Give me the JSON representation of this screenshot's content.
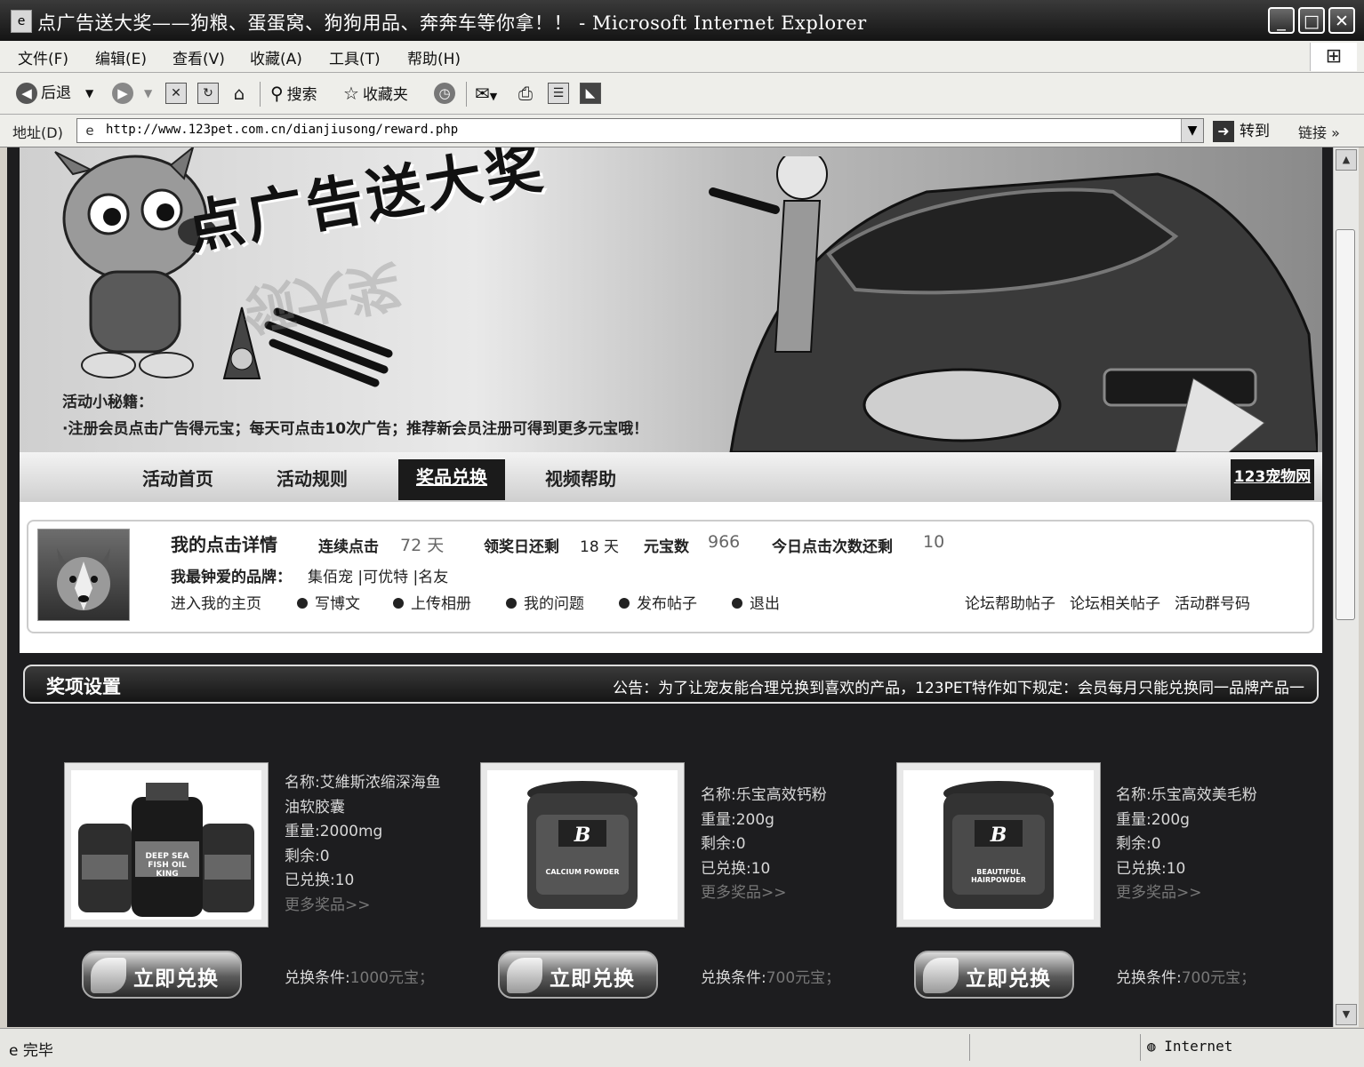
{
  "window": {
    "title": "点广告送大奖——狗粮、蛋蛋窝、狗狗用品、奔奔车等你拿！！ - Microsoft Internet Explorer"
  },
  "menu": [
    "文件(F)",
    "编辑(E)",
    "查看(V)",
    "收藏(A)",
    "工具(T)",
    "帮助(H)"
  ],
  "toolbar": {
    "back": "后退",
    "search": "搜索",
    "favorites": "收藏夹"
  },
  "address": {
    "label": "地址(D)",
    "url": "http://www.123pet.com.cn/dianjiusong/reward.php",
    "go": "转到",
    "links": "链接"
  },
  "banner": {
    "title": "点广告送大奖",
    "tip_title": "活动小秘籍：",
    "tip_text": "·注册会员点击广告得元宝；每天可点击10次广告；推荐新会员注册可得到更多元宝哦！"
  },
  "nav": {
    "items": [
      "活动首页",
      "活动规则",
      "奖品兑换",
      "视频帮助"
    ],
    "active": "奖品兑换",
    "site": "123宠物网"
  },
  "user": {
    "heading": "我的点击详情",
    "consecutive_label": "连续点击",
    "consecutive_value": "72 天",
    "days_left_label": "领奖日还剩",
    "days_left_value": "18 天",
    "ingots_label": "元宝数",
    "ingots_value": "966",
    "clicks_left_label": "今日点击次数还剩",
    "clicks_left_value": "10",
    "brands_label": "我最钟爱的品牌：",
    "brands": "集佰宠 |可优特 |名友",
    "links": [
      "进入我的主页",
      "写博文",
      "上传相册",
      "我的问题",
      "发布帖子",
      "退出"
    ],
    "right_links": [
      "论坛帮助帖子",
      "论坛相关帖子",
      "活动群号码"
    ]
  },
  "prizes": {
    "heading": "奖项设置",
    "notice": "公告：为了让宠友能合理兑换到喜欢的产品，123PET特作如下规定：会员每月只能兑换同一品牌产品一",
    "items": [
      {
        "name_line1": "名称:艾維斯浓缩深海鱼",
        "name_line2": "油软胶囊",
        "weight": "重量:2000mg",
        "remain": "剩余:0",
        "exchanged": "已兑换:10",
        "more": "更多奖品>>",
        "button": "立即兑换",
        "cond_label": "兑换条件:",
        "cond_value": "1000元宝；",
        "product_text": "DEEP SEA FISH OIL KING"
      },
      {
        "name_line1": "名称:乐宝高效钙粉",
        "name_line2": "",
        "weight": "重量:200g",
        "remain": "剩余:0",
        "exchanged": "已兑换:10",
        "more": "更多奖品>>",
        "button": "立即兑换",
        "cond_label": "兑换条件:",
        "cond_value": "700元宝；",
        "product_text": "CALCIUM POWDER"
      },
      {
        "name_line1": "名称:乐宝高效美毛粉",
        "name_line2": "",
        "weight": "重量:200g",
        "remain": "剩余:0",
        "exchanged": "已兑换:10",
        "more": "更多奖品>>",
        "button": "立即兑换",
        "cond_label": "兑换条件:",
        "cond_value": "700元宝；",
        "product_text": "BEAUTIFUL HAIRPOWDER"
      }
    ]
  },
  "status": {
    "left": "完毕",
    "zone": "Internet"
  }
}
